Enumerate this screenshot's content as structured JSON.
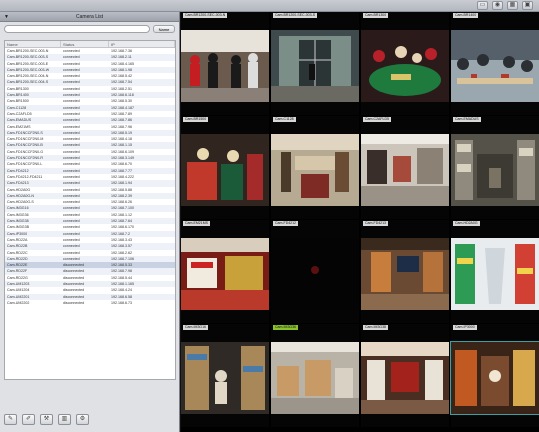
{
  "sidebar": {
    "title": "Camera List",
    "search_placeholder": "",
    "search_button": "Name",
    "columns": [
      "Name",
      "Status",
      "IP"
    ],
    "rows": [
      [
        "Cam-BR1200-SEC-003-N",
        "connected",
        "192.168.7.36"
      ],
      [
        "Cam-BR1200-SEC-003-S",
        "connected",
        "192.168.2.11"
      ],
      [
        "Cam-BR1200-SEC-003-E",
        "connected",
        "192.168.4.165"
      ],
      [
        "Cam-BR1200-SEC-003-W",
        "connected",
        "192.168.1.98"
      ],
      [
        "Cam-BR1200-SEC-004-N",
        "connected",
        "192.168.5.42"
      ],
      [
        "Cam-BR1200-SEC-004-S",
        "connected",
        "192.168.7.54"
      ],
      [
        "Cam-BR1300",
        "connected",
        "192.168.2.51"
      ],
      [
        "Cam-BR1400",
        "connected",
        "192.168.6.118"
      ],
      [
        "Cam-BR1500",
        "connected",
        "192.168.5.30"
      ],
      [
        "Cam-C1128",
        "connected",
        "192.168.4.187"
      ],
      [
        "Cam-C2AFLD5",
        "connected",
        "192.168.7.89"
      ],
      [
        "Cam-EMADUS",
        "connected",
        "192.168.7.86"
      ],
      [
        "Cam-EM21MS",
        "connected",
        "192.168.7.96"
      ],
      [
        "Cam-FD1NCCF2N0-S",
        "connected",
        "192.168.5.19"
      ],
      [
        "Cam-FD1NCCF2N0-M",
        "connected",
        "192.168.4.18"
      ],
      [
        "Cam-FD1NCCF2N0-B",
        "connected",
        "192.168.1.15"
      ],
      [
        "Cam-FD1NCCF2N0-G",
        "connected",
        "192.168.6.109"
      ],
      [
        "Cam-FD1NCCF2N0-R",
        "connected",
        "192.168.3.149"
      ],
      [
        "Cam-FD1NCCF2N0-L",
        "connected",
        "192.168.6.70"
      ],
      [
        "Cam-FD4212",
        "connected",
        "192.168.7.77"
      ],
      [
        "Cam-FD4212-FD4211",
        "connected",
        "192.168.4.222"
      ],
      [
        "Cam-FD4213",
        "connected",
        "192.168.1.94"
      ],
      [
        "Cam-HD2A0G",
        "connected",
        "192.168.5.88"
      ],
      [
        "Cam-HD2A0G-N",
        "connected",
        "192.168.2.39"
      ],
      [
        "Cam-HD2A0G-S",
        "connected",
        "192.168.6.26"
      ],
      [
        "Cam-IM3G16",
        "connected",
        "192.168.7.100"
      ],
      [
        "Cam-IM3G36",
        "connected",
        "192.168.1.12"
      ],
      [
        "Cam-IM3G38",
        "connected",
        "192.168.7.64"
      ],
      [
        "Cam-IM3G3B",
        "connected",
        "192.168.6.170"
      ],
      [
        "Cam-IP3000",
        "connected",
        "192.168.7.2"
      ],
      [
        "Cam-RD22A",
        "connected",
        "192.168.3.43"
      ],
      [
        "Cam-RD22B",
        "connected",
        "192.168.3.57"
      ],
      [
        "Cam-RD22C",
        "connected",
        "192.168.2.62"
      ],
      [
        "Cam-RD22D",
        "connected",
        "192.168.7.106"
      ],
      [
        "Cam-RD22E",
        "disconnected",
        "192.168.5.33"
      ],
      [
        "Cam-RD22F",
        "disconnected",
        "192.168.7.98"
      ],
      [
        "Cam-RD22G",
        "disconnected",
        "192.168.5.44"
      ],
      [
        "Cam-UM1203",
        "disconnected",
        "192.168.1.165"
      ],
      [
        "Cam-UM1204",
        "disconnected",
        "192.168.4.24"
      ],
      [
        "Cam-UM2201",
        "disconnected",
        "192.168.6.58"
      ],
      [
        "Cam-UM2202",
        "disconnected",
        "192.168.6.73"
      ]
    ],
    "selected_row": 34,
    "tools": [
      "edit-icon",
      "edit-alt-icon",
      "wrench-icon",
      "trash-icon",
      "settings-icon"
    ]
  },
  "topbar": {
    "icons": [
      "layout-icon",
      "eye-icon",
      "grid-icon",
      "camera-icon"
    ]
  },
  "wall": {
    "tiles": [
      {
        "label": "Cam-BR1200-SEC-003-N",
        "scene": "crowd",
        "active": false
      },
      {
        "label": "Cam-BR1200-SEC-003-S",
        "scene": "lobby",
        "active": false
      },
      {
        "label": "Cam-BR1300",
        "scene": "casino",
        "active": false
      },
      {
        "label": "Cam-BR1400",
        "scene": "restaurant",
        "active": false
      },
      {
        "label": "Cam-BR1500",
        "scene": "casino2",
        "active": false
      },
      {
        "label": "Cam-C1128",
        "scene": "shop",
        "active": false
      },
      {
        "label": "Cam-C2AFLD5",
        "scene": "store",
        "active": false
      },
      {
        "label": "Cam-EMADUS",
        "scene": "warehouse",
        "active": false
      },
      {
        "label": "Cam-EM21MS",
        "scene": "mall",
        "active": false
      },
      {
        "label": "Cam-FD4212",
        "scene": "dark",
        "active": false
      },
      {
        "label": "Cam-FD4213",
        "scene": "store2",
        "active": false
      },
      {
        "label": "Cam-HD2A0G",
        "scene": "aisle",
        "active": false
      },
      {
        "label": "Cam-IM3G16",
        "scene": "shelves",
        "active": false
      },
      {
        "label": "Cam-IM3G36",
        "scene": "boxes",
        "active": true
      },
      {
        "label": "Cam-IM3G38",
        "scene": "boutique",
        "active": false
      },
      {
        "label": "Cam-IP3000",
        "scene": "warehouse2",
        "active": false
      }
    ]
  },
  "colors": {
    "active_label": "#8ac22c",
    "focus_outline": "#3c9fa3"
  }
}
